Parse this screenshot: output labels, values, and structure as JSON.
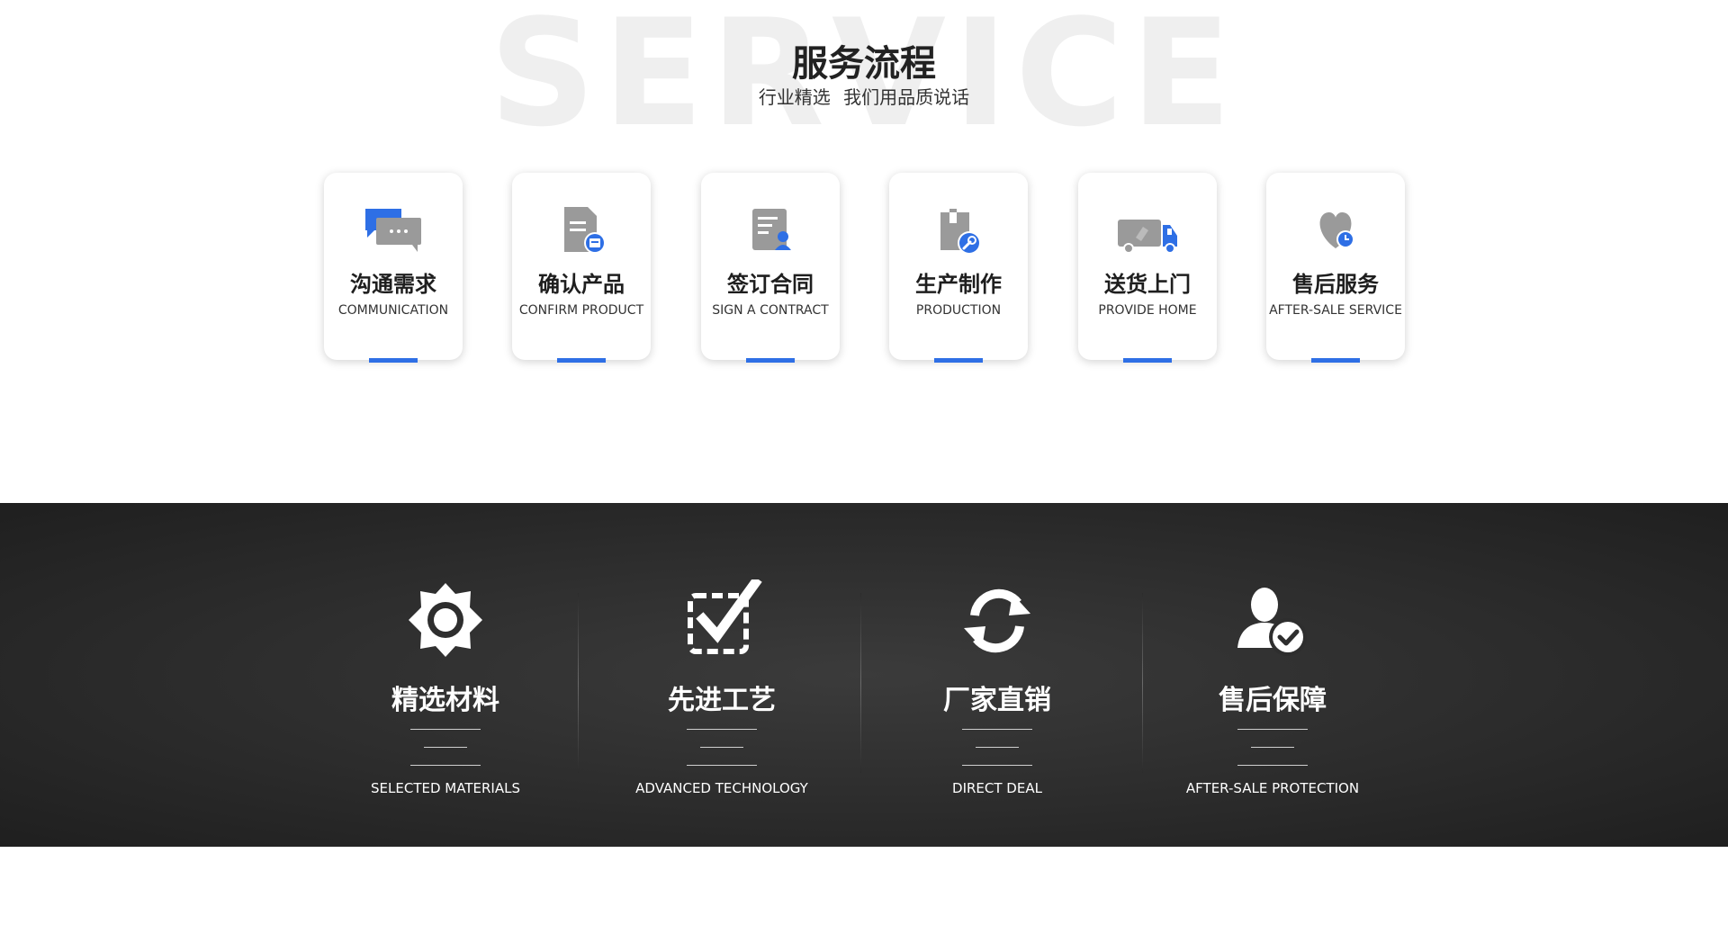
{
  "header": {
    "background_word": "SERVICE",
    "title": "服务流程",
    "subtitle": "行业精选 我们用品质说话"
  },
  "accent_color": "#2e6fe5",
  "process_steps": [
    {
      "title": "沟通需求",
      "subtitle": "COMMUNICATION",
      "icon": "chat-bubbles-icon"
    },
    {
      "title": "确认产品",
      "subtitle": "CONFIRM PRODUCT",
      "icon": "document-check-icon"
    },
    {
      "title": "签订合同",
      "subtitle": "SIGN A CONTRACT",
      "icon": "contract-signer-icon"
    },
    {
      "title": "生产制作",
      "subtitle": "PRODUCTION",
      "icon": "wrench-document-icon"
    },
    {
      "title": "送货上门",
      "subtitle": "PROVIDE HOME",
      "icon": "delivery-truck-icon"
    },
    {
      "title": "售后服务",
      "subtitle": "AFTER-SALE SERVICE",
      "icon": "heart-clock-icon"
    }
  ],
  "features": [
    {
      "title": "精选材料",
      "subtitle": "SELECTED MATERIALS",
      "icon": "gear-icon"
    },
    {
      "title": "先进工艺",
      "subtitle": "ADVANCED TECHNOLOGY",
      "icon": "checkbox-icon"
    },
    {
      "title": "厂家直销",
      "subtitle": "DIRECT DEAL",
      "icon": "refresh-icon"
    },
    {
      "title": "售后保障",
      "subtitle": "AFTER-SALE PROTECTION",
      "icon": "user-check-icon"
    }
  ]
}
